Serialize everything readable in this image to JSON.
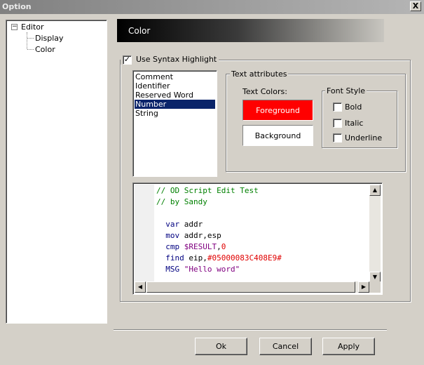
{
  "window": {
    "title": "Option",
    "close_glyph": "X"
  },
  "tree": {
    "root": {
      "label": "Editor",
      "expander": "−"
    },
    "children": [
      {
        "label": "Display"
      },
      {
        "label": "Color"
      }
    ]
  },
  "header": {
    "title": "Color"
  },
  "syntax": {
    "checkbox_label": "Use Syntax Highlight",
    "checked": true,
    "check_glyph": "✓"
  },
  "token_list": {
    "items": [
      "Comment",
      "Identifier",
      "Reserved Word",
      "Number",
      "String"
    ],
    "selected_index": 3
  },
  "text_attributes": {
    "group_label": "Text attributes",
    "text_colors_label": "Text Colors:",
    "foreground": {
      "label": "Foreground",
      "color": "#ff0000"
    },
    "background": {
      "label": "Background",
      "color": "#ffffff"
    },
    "font_style": {
      "group_label": "Font Style",
      "bold": {
        "label": "Bold",
        "checked": false
      },
      "italic": {
        "label": "Italic",
        "checked": false
      },
      "underline": {
        "label": "Underline",
        "checked": false
      }
    }
  },
  "preview": {
    "lines": [
      [
        {
          "t": "// OD Script Edit Test",
          "c": "comment"
        }
      ],
      [
        {
          "t": "// by Sandy",
          "c": "comment"
        }
      ],
      [],
      [
        {
          "t": "  var",
          "c": "kw"
        },
        {
          "t": " addr",
          "c": "plain"
        }
      ],
      [
        {
          "t": "  mov",
          "c": "kw"
        },
        {
          "t": " addr,esp",
          "c": "plain"
        }
      ],
      [
        {
          "t": "  cmp",
          "c": "kw"
        },
        {
          "t": " ",
          "c": "plain"
        },
        {
          "t": "$RESULT",
          "c": "var"
        },
        {
          "t": ",",
          "c": "plain"
        },
        {
          "t": "0",
          "c": "hex"
        }
      ],
      [
        {
          "t": "  find",
          "c": "kw"
        },
        {
          "t": " eip,",
          "c": "plain"
        },
        {
          "t": "#05000083C408E9#",
          "c": "hex"
        }
      ],
      [
        {
          "t": "  MSG",
          "c": "kw"
        },
        {
          "t": " ",
          "c": "plain"
        },
        {
          "t": "\"Hello word\"",
          "c": "str"
        }
      ]
    ]
  },
  "buttons": {
    "ok": "Ok",
    "cancel": "Cancel",
    "apply": "Apply"
  },
  "scroll_glyphs": {
    "up": "▲",
    "down": "▼",
    "left": "◀",
    "right": "▶"
  }
}
